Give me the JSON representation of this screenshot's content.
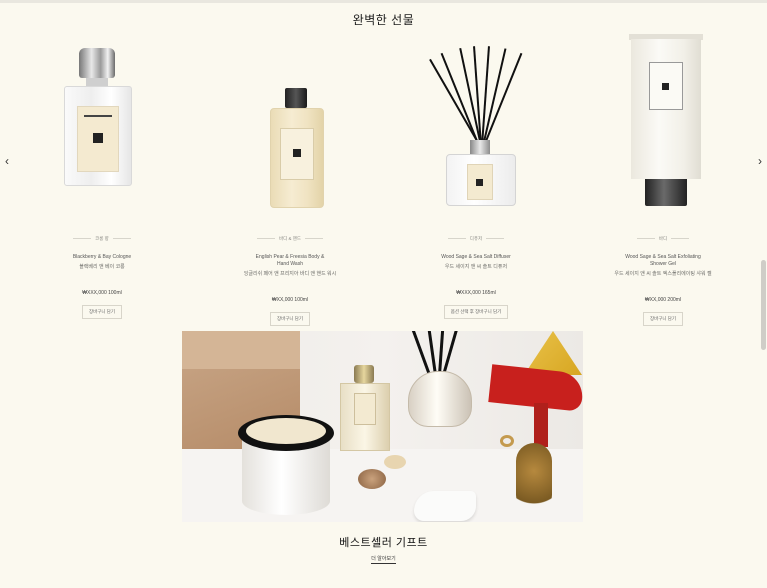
{
  "section": {
    "title": "완벽한 선물"
  },
  "nav": {
    "prev_glyph": "‹",
    "next_glyph": "›"
  },
  "products": [
    {
      "category": "코롱 향",
      "name_en": "Blackberry & Bay Cologne",
      "name_ko": "블랙베리 앤 베이 코롱",
      "price": "₩XXX,000 100ml",
      "button": "장바구니 담기",
      "image_icon": "cologne-bottle-icon"
    },
    {
      "category": "바디 & 핸드",
      "name_en": "English Pear & Freesia Body & Hand Wash",
      "name_ko": "잉글리쉬 페어 앤 프리지아 바디 앤 핸드 워시",
      "price": "₩XX,000 100ml",
      "button": "장바구니 담기",
      "image_icon": "body-wash-bottle-icon"
    },
    {
      "category": "디퓨저",
      "name_en": "Wood Sage & Sea Salt Diffuser",
      "name_ko": "우드 세이지 앤 씨 솔트 디퓨저",
      "price": "₩XXX,000 165ml",
      "button": "옵션 선택 후 장바구니 담기",
      "image_icon": "diffuser-icon"
    },
    {
      "category": "바디",
      "name_en": "Wood Sage & Sea Salt Exfoliating Shower Gel",
      "name_ko": "우드 세이지 앤 씨 솔트 엑스폴리에이팅 샤워 젤",
      "price": "₩XX,000 200ml",
      "button": "장바구니 담기",
      "image_icon": "tube-icon"
    }
  ],
  "bestseller": {
    "title": "베스트셀러 기프트",
    "link": "더 알아보기",
    "image_icon": "gift-lifestyle-photo"
  }
}
